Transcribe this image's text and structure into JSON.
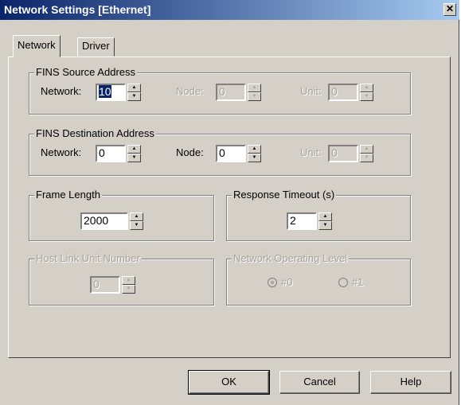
{
  "window": {
    "title": "Network Settings [Ethernet]",
    "close_glyph": "✕"
  },
  "tabs": [
    {
      "label": "Network",
      "active": true
    },
    {
      "label": "Driver",
      "active": false
    }
  ],
  "fins_source": {
    "title": "FINS Source Address",
    "network": {
      "label": "Network:",
      "value": "10"
    },
    "node": {
      "label": "Node:",
      "value": "0"
    },
    "unit": {
      "label": "Unit:",
      "value": "0"
    }
  },
  "fins_destination": {
    "title": "FINS Destination Address",
    "network": {
      "label": "Network:",
      "value": "0"
    },
    "node": {
      "label": "Node:",
      "value": "0"
    },
    "unit": {
      "label": "Unit:",
      "value": "0"
    }
  },
  "frame_length": {
    "title": "Frame Length",
    "value": "2000"
  },
  "response_timeout": {
    "title": "Response Timeout (s)",
    "value": "2"
  },
  "host_link": {
    "title": "Host Link Unit Number",
    "value": "0"
  },
  "network_level": {
    "title": "Network Operating Level",
    "options": [
      "#0",
      "#1"
    ],
    "selected": "#0"
  },
  "buttons": {
    "ok": "OK",
    "cancel": "Cancel",
    "help": "Help"
  },
  "colors": {
    "face": "#d4d0c8",
    "title_start": "#0a246a",
    "title_end": "#a6caf0",
    "disabled_text": "#a6a39c"
  },
  "icons": {
    "spin_up": "▲",
    "spin_down": "▼"
  }
}
